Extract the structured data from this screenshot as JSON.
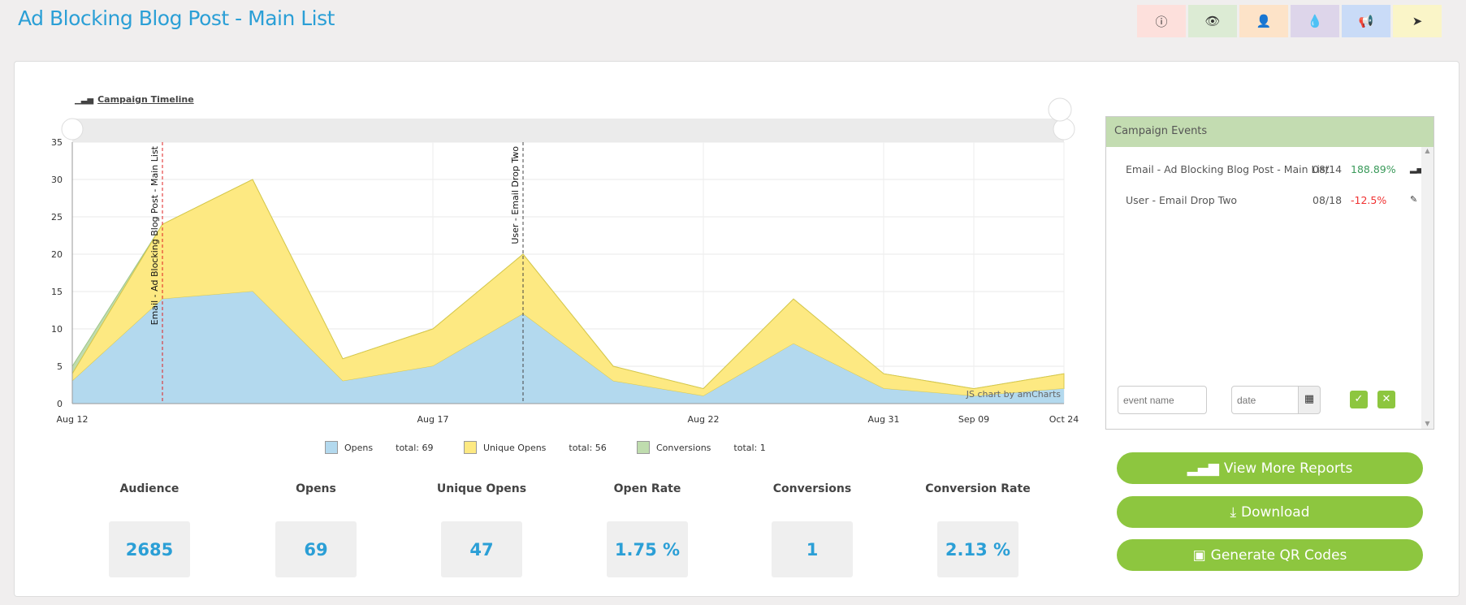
{
  "header": {
    "title": "Ad Blocking Blog Post - Main List",
    "icon_buttons": [
      {
        "icon": "info-icon",
        "glyph": "ⓘ",
        "color": "#fde0dc"
      },
      {
        "icon": "eye-icon",
        "glyph": "👁",
        "color": "#dcebd4"
      },
      {
        "icon": "user-icon",
        "glyph": "👤",
        "color": "#fde3c8"
      },
      {
        "icon": "drop-icon",
        "glyph": "💧",
        "color": "#ddd5ea"
      },
      {
        "icon": "megaphone-icon",
        "glyph": "📢",
        "color": "#c9dbf7"
      },
      {
        "icon": "send-icon",
        "glyph": "➤",
        "color": "#faf5c8"
      }
    ]
  },
  "chart_title": "Campaign Timeline",
  "chart_data": {
    "type": "area",
    "stacked": true,
    "categories": [
      "Aug 12",
      "",
      "",
      "",
      "Aug 17",
      "",
      "",
      "Aug 22",
      "",
      "Aug 31",
      "Sep 09",
      "Oct 24"
    ],
    "ylim": [
      0,
      35
    ],
    "yticks": [
      0,
      5,
      10,
      15,
      20,
      25,
      30,
      35
    ],
    "grid": true,
    "series": [
      {
        "name": "Opens",
        "color": "#b3d9ee",
        "values": [
          3,
          14,
          15,
          3,
          5,
          12,
          3,
          1,
          8,
          2,
          1,
          2
        ]
      },
      {
        "name": "Unique Opens",
        "color": "#fde982",
        "values": [
          1,
          10,
          15,
          3,
          5,
          8,
          2,
          1,
          6,
          2,
          1,
          2
        ]
      },
      {
        "name": "Conversions",
        "color": "#bfdcae",
        "values": [
          1,
          0,
          0,
          0,
          0,
          0,
          0,
          0,
          0,
          0,
          0,
          0
        ]
      }
    ],
    "events": [
      {
        "index": 1,
        "label": "Email - Ad Blocking Blog Post - Main List",
        "color": "#e02020"
      },
      {
        "index": 5,
        "label": "User - Email Drop Two",
        "color": "#444"
      }
    ],
    "credit": "JS chart by amCharts"
  },
  "legend": [
    {
      "name": "Opens",
      "total": "total: 69",
      "color": "#b3d9ee"
    },
    {
      "name": "Unique Opens",
      "total": "total: 56",
      "color": "#fde982"
    },
    {
      "name": "Conversions",
      "total": "total: 1",
      "color": "#bfdcae"
    }
  ],
  "stats": [
    {
      "label": "Audience",
      "value": "2685"
    },
    {
      "label": "Opens",
      "value": "69"
    },
    {
      "label": "Unique Opens",
      "value": "47"
    },
    {
      "label": "Open Rate",
      "value": "1.75 %"
    },
    {
      "label": "Conversions",
      "value": "1"
    },
    {
      "label": "Conversion Rate",
      "value": "2.13 %"
    }
  ],
  "events_panel": {
    "title": "Campaign Events",
    "items": [
      {
        "name": "Email - Ad Blocking Blog Post - Main List",
        "date": "08/14",
        "pct": "188.89%",
        "pct_color": "#3a9a5a",
        "icon": "bar-chart-icon"
      },
      {
        "name": "User - Email Drop Two",
        "date": "08/18",
        "pct": "-12.5%",
        "pct_color": "#f03030",
        "icon": "edit-icon"
      }
    ],
    "event_name_placeholder": "event name",
    "date_placeholder": "date"
  },
  "buttons": {
    "reports": "View More Reports",
    "download": "Download",
    "qr": "Generate QR Codes"
  }
}
